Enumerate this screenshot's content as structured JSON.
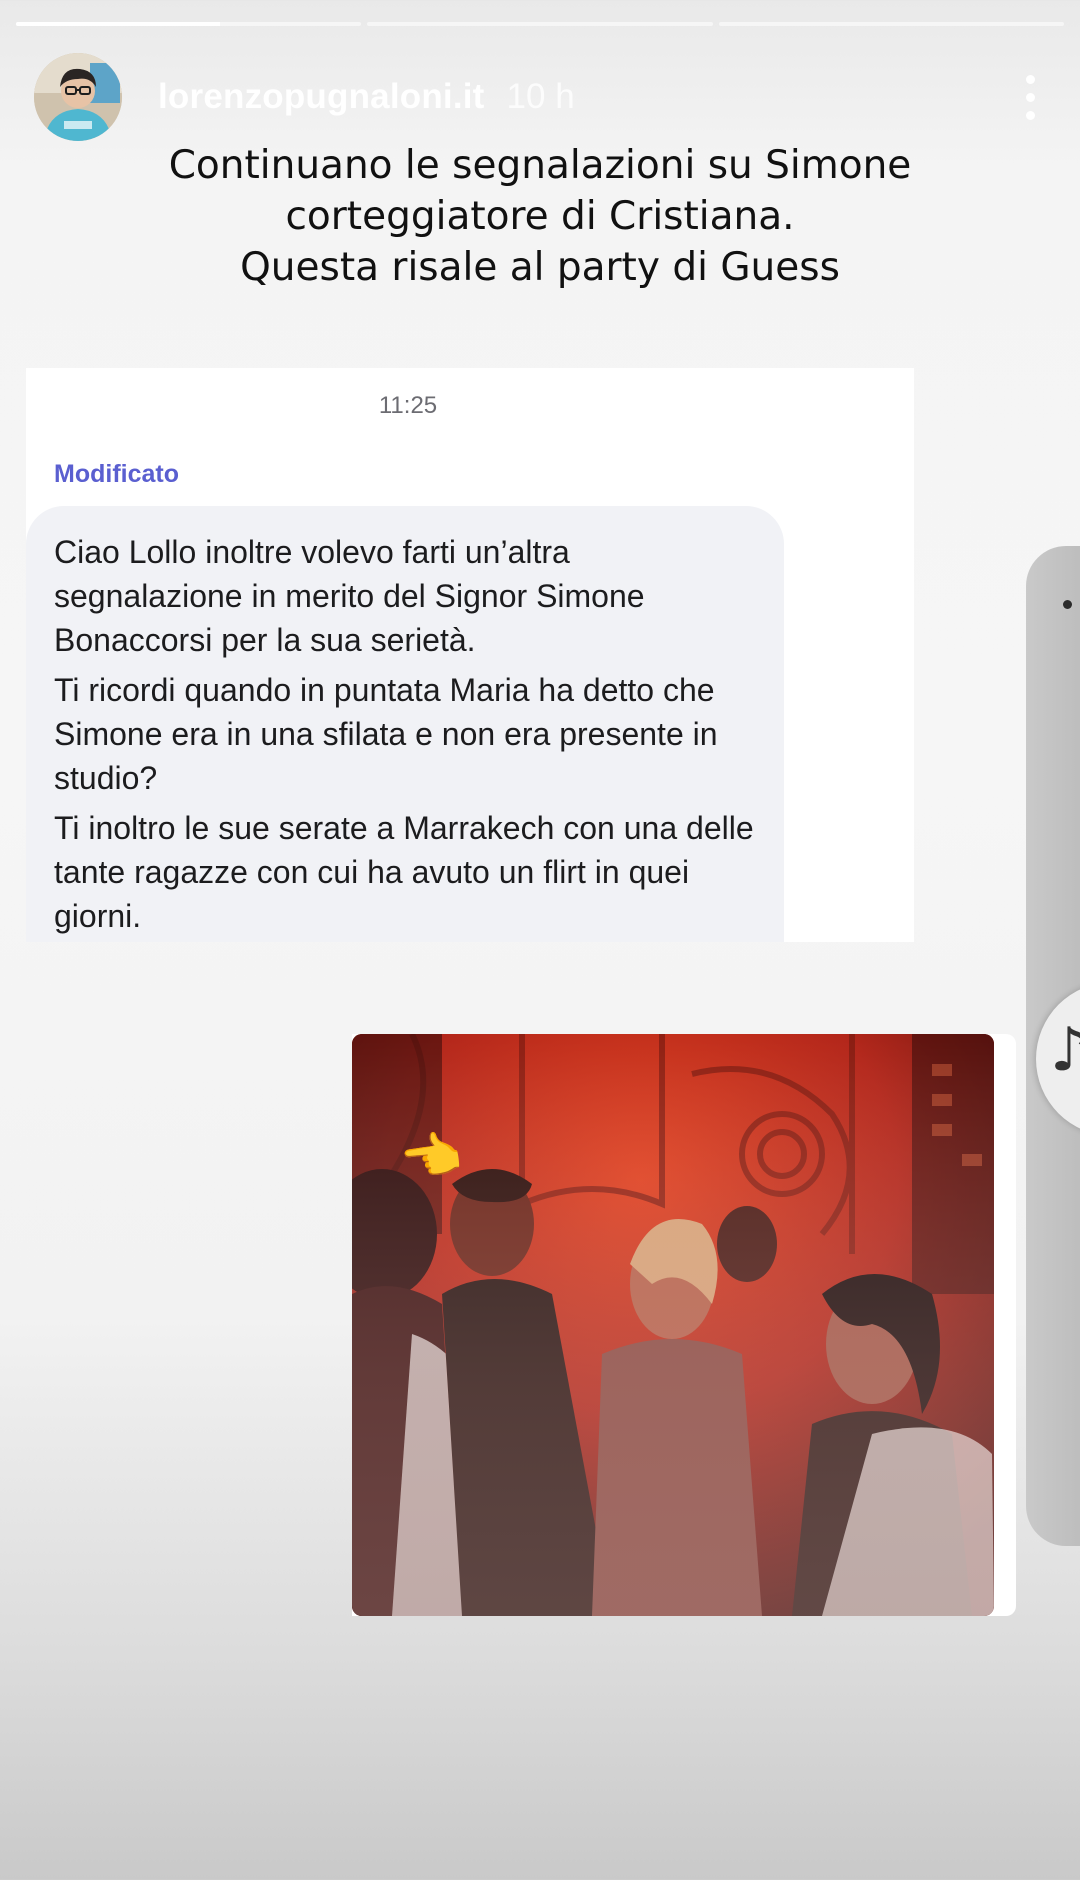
{
  "story": {
    "progress_segments": [
      {
        "fill": 1.0
      },
      {
        "fill": 0.0
      },
      {
        "fill": 0.0
      }
    ],
    "progress_fill_first": 0.59,
    "username": "lorenzopugnaloni.it",
    "time_ago": "10 h",
    "avatar_icon": "profile-avatar",
    "more_icon": "more-vertical-icon",
    "caption_lines": [
      "Continuano le segnalazioni su Simone",
      "corteggiatore di Cristiana.",
      "Questa risale al party di Guess"
    ]
  },
  "chat": {
    "time": "11:25",
    "edited_label": "Modificato",
    "message_paragraphs": [
      "Ciao Lollo inoltre volevo farti un’altra segnalazione in merito del Signor Simone Bonaccorsi per la sua serietà.",
      "Ti ricordi quando in puntata Maria ha detto che Simone era in una sfilata e non era presente in studio?",
      "Ti inoltro le sue serate a Marrakech con una delle tante ragazze con cui ha avuto un flirt in quei giorni."
    ],
    "photo_overlay_emoji": "👈",
    "photo_description_icon": "party-photo"
  },
  "side": {
    "music_icon": "♪"
  }
}
